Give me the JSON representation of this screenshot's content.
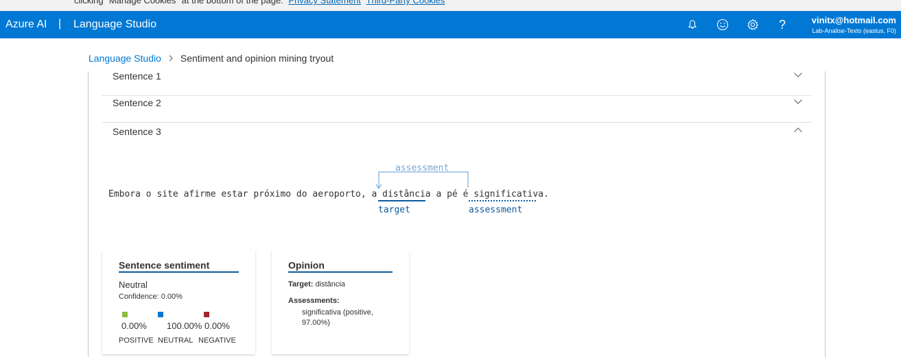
{
  "cookie": {
    "text": "clicking \"Manage Cookies\" at the bottom of the page.",
    "privacy_link": "Privacy Statement",
    "third_party_link": "Third-Party Cookies"
  },
  "header": {
    "brand": "Azure AI",
    "separator": "|",
    "product": "Language Studio",
    "icons": [
      "bell-icon",
      "smiley-icon",
      "gear-icon",
      "help-icon"
    ],
    "help_glyph": "?",
    "account_email": "vinitx@hotmail.com",
    "account_resource": "Lab-Analise-Texto (eastus, F0)",
    "bg_color": "#0078d4"
  },
  "breadcrumb": {
    "root": "Language Studio",
    "current": "Sentiment and opinion mining tryout"
  },
  "sentences": [
    {
      "label": "Sentence 1",
      "expanded": false
    },
    {
      "label": "Sentence 2",
      "expanded": false
    },
    {
      "label": "Sentence 3",
      "expanded": true
    }
  ],
  "annotation": {
    "arc_label": "assessment",
    "text_before": "Embora o site afirme estar próximo do aeroporto, a ",
    "target_word": "distância",
    "text_middle": " a pé é ",
    "assessment_word": "significativa",
    "text_after": ".",
    "target_tag": "target",
    "assessment_tag": "assessment"
  },
  "sentence_sentiment": {
    "title": "Sentence sentiment",
    "value": "Neutral",
    "confidence": "Confidence: 0.00%",
    "scores": [
      {
        "label": "POSITIVE",
        "value": "0.00%",
        "color": "#8cbd3f"
      },
      {
        "label": "NEUTRAL",
        "value": "100.00%",
        "color": "#0078d4"
      },
      {
        "label": "NEGATIVE",
        "value": "0.00%",
        "color": "#a4262c"
      }
    ]
  },
  "opinion": {
    "title": "Opinion",
    "target_label": "Target:",
    "target_value": "distância",
    "assessments_label": "Assessments:",
    "assessment_value": "significativa (positive, 97.00%)"
  }
}
